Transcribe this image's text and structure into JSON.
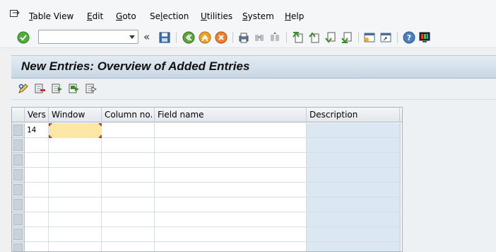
{
  "menu": {
    "items": [
      {
        "pre": "",
        "acc": "T",
        "post": "able View"
      },
      {
        "pre": "",
        "acc": "E",
        "post": "dit"
      },
      {
        "pre": "",
        "acc": "G",
        "post": "oto"
      },
      {
        "pre": "Se",
        "acc": "l",
        "post": "ection"
      },
      {
        "pre": "",
        "acc": "U",
        "post": "tilities"
      },
      {
        "pre": "",
        "acc": "S",
        "post": "ystem"
      },
      {
        "pre": "",
        "acc": "H",
        "post": "elp"
      }
    ]
  },
  "toolbar": {
    "command_field": {
      "value": "",
      "placeholder": ""
    },
    "back_label": "«"
  },
  "title": "New Entries: Overview of Added Entries",
  "table": {
    "columns": [
      "Vers",
      "Window",
      "Column no.",
      "Field name",
      "Description"
    ],
    "rows": [
      [
        "14",
        "",
        "",
        "",
        ""
      ],
      [
        "",
        "",
        "",
        "",
        ""
      ],
      [
        "",
        "",
        "",
        "",
        ""
      ],
      [
        "",
        "",
        "",
        "",
        ""
      ],
      [
        "",
        "",
        "",
        "",
        ""
      ],
      [
        "",
        "",
        "",
        "",
        ""
      ],
      [
        "",
        "",
        "",
        "",
        ""
      ],
      [
        "",
        "",
        "",
        "",
        ""
      ],
      [
        "",
        "",
        "",
        "",
        ""
      ]
    ]
  },
  "colors": {
    "title_gradient_top": "#e4ecf3",
    "description_column": "#dbe7f2",
    "editing_cell": "#fce8a4"
  }
}
